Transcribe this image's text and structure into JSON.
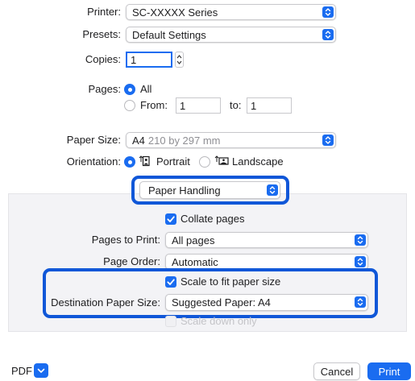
{
  "printer": {
    "label": "Printer:",
    "value": "SC-XXXXX Series"
  },
  "presets": {
    "label": "Presets:",
    "value": "Default Settings"
  },
  "copies": {
    "label": "Copies:",
    "value": "1"
  },
  "pages": {
    "label": "Pages:",
    "all_label": "All",
    "from_label": "From:",
    "from_value": "1",
    "to_label": "to:",
    "to_value": "1",
    "selected": "All"
  },
  "paper_size": {
    "label": "Paper Size:",
    "value_main": "A4",
    "value_detail": "210 by 297 mm"
  },
  "orientation": {
    "label": "Orientation:",
    "portrait_label": "Portrait",
    "landscape_label": "Landscape",
    "selected": "Portrait"
  },
  "section_popup": {
    "value": "Paper Handling"
  },
  "paper_handling": {
    "collate": {
      "label": "Collate pages",
      "checked": true
    },
    "pages_to_print": {
      "label": "Pages to Print:",
      "value": "All pages"
    },
    "page_order": {
      "label": "Page Order:",
      "value": "Automatic"
    },
    "scale_to_fit": {
      "label": "Scale to fit paper size",
      "checked": true
    },
    "destination_paper_size": {
      "label": "Destination Paper Size:",
      "value": "Suggested Paper: A4"
    },
    "scale_down_only": {
      "label": "Scale down only",
      "checked": false,
      "enabled": false
    }
  },
  "footer": {
    "pdf_label": "PDF",
    "cancel_label": "Cancel",
    "print_label": "Print"
  },
  "colors": {
    "accent": "#1a6cf0",
    "highlight": "#1057d8",
    "panel": "#f3f3f6"
  }
}
